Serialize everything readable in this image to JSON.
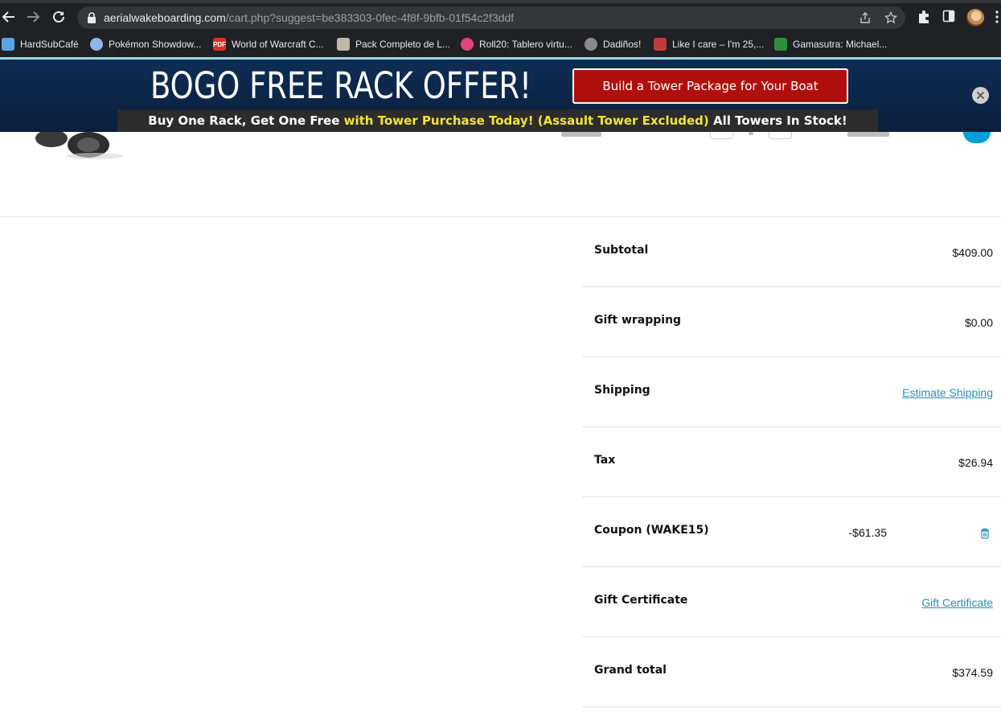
{
  "browser": {
    "url_domain": "aerialwakeboarding.com",
    "url_path": "/cart.php?suggest=be383303-0fec-4f8f-9bfb-01f54c2f3ddf",
    "bookmarks": [
      {
        "label": "HardSubCafé",
        "icon": "hardsubcafe-favicon",
        "color": "#5aa5e8"
      },
      {
        "label": "Pokémon Showdow...",
        "icon": "pokemon-showdown-favicon",
        "color": "#8fb6e8"
      },
      {
        "label": "World of Warcraft C...",
        "icon": "pdf-favicon",
        "color": "#d93025"
      },
      {
        "label": "Pack Completo de L...",
        "icon": "pack-favicon",
        "color": "#c0b8a8"
      },
      {
        "label": "Roll20: Tablero virtu...",
        "icon": "roll20-favicon",
        "color": "#e0457b"
      },
      {
        "label": "Dadiños!",
        "icon": "globe-favicon",
        "color": "#8a8a8a"
      },
      {
        "label": "Like I care – I'm 25,...",
        "icon": "likeicare-favicon",
        "color": "#c23b3b"
      },
      {
        "label": "Gamasutra: Michael...",
        "icon": "gamasutra-favicon",
        "color": "#2f8f3a"
      }
    ]
  },
  "banner": {
    "title": "BOGO FREE RACK OFFER!",
    "cta": "Build a Tower Package for Your Boat",
    "strip_white_1": "Buy One Rack, Get One Free ",
    "strip_yellow": "with Tower Purchase Today! (Assault Tower Excluded) ",
    "strip_white_2": "All Towers In Stock!"
  },
  "totals": {
    "subtotal": {
      "label": "Subtotal",
      "value": "$409.00"
    },
    "gift_wrapping": {
      "label": "Gift wrapping",
      "value": "$0.00"
    },
    "shipping": {
      "label": "Shipping",
      "link": "Estimate Shipping"
    },
    "tax": {
      "label": "Tax",
      "value": "$26.94"
    },
    "coupon": {
      "label": "Coupon (WAKE15)",
      "value": "-$61.35"
    },
    "gift_certificate": {
      "label": "Gift Certificate",
      "link": "Gift Certificate"
    },
    "grand_total": {
      "label": "Grand total",
      "value": "$374.59"
    }
  },
  "colors": {
    "banner_bg": "#0c2547",
    "cta_red": "#b0100d",
    "strip_yellow": "#f2e33b",
    "link_blue": "#2a8fb4",
    "accent_cyan": "#00a1d6"
  }
}
